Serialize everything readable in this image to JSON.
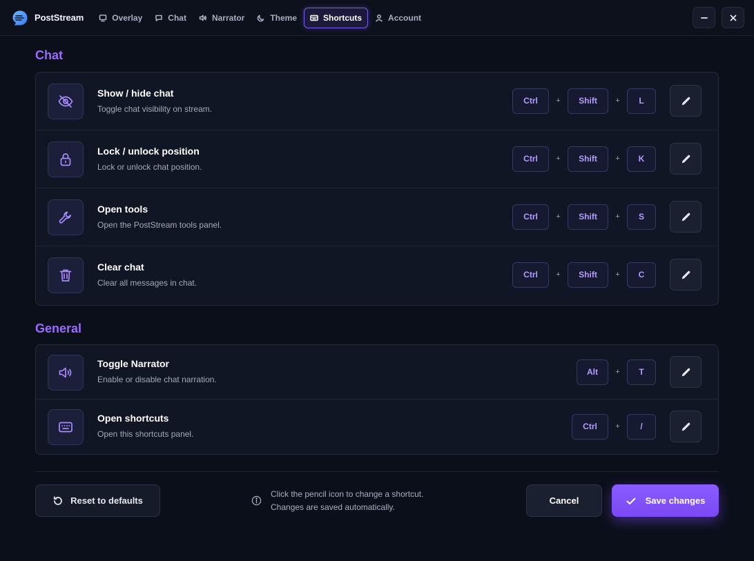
{
  "app": {
    "name": "PostStream",
    "logo_icon": "poststream-logo-icon"
  },
  "nav": {
    "items": [
      {
        "label": "Overlay",
        "icon": "monitor-icon",
        "active": false
      },
      {
        "label": "Chat",
        "icon": "chat-bubble-icon",
        "active": false
      },
      {
        "label": "Narrator",
        "icon": "speaker-icon",
        "active": false
      },
      {
        "label": "Theme",
        "icon": "moon-icon",
        "active": false
      },
      {
        "label": "Shortcuts",
        "icon": "keyboard-icon",
        "active": true
      },
      {
        "label": "Account",
        "icon": "user-icon",
        "active": false
      }
    ]
  },
  "window": {
    "minimize_icon": "minimize-icon",
    "close_icon": "close-icon"
  },
  "sections": [
    {
      "title": "Chat",
      "rows": [
        {
          "title": "Show / hide chat",
          "desc": "Toggle chat visibility on stream.",
          "icon": "eye-off-icon",
          "keys": [
            "Ctrl",
            "Shift",
            "L"
          ]
        },
        {
          "title": "Lock / unlock position",
          "desc": "Lock or unlock chat position.",
          "icon": "lock-icon",
          "keys": [
            "Ctrl",
            "Shift",
            "K"
          ]
        },
        {
          "title": "Open tools",
          "desc": "Open the PostStream tools panel.",
          "icon": "wrench-icon",
          "keys": [
            "Ctrl",
            "Shift",
            "S"
          ]
        },
        {
          "title": "Clear chat",
          "desc": "Clear all messages in chat.",
          "icon": "trash-icon",
          "keys": [
            "Ctrl",
            "Shift",
            "C"
          ]
        }
      ]
    },
    {
      "title": "General",
      "rows": [
        {
          "title": "Toggle Narrator",
          "desc": "Enable or disable chat narration.",
          "icon": "speaker-icon",
          "keys": [
            "Alt",
            "T"
          ]
        },
        {
          "title": "Open shortcuts",
          "desc": "Open this shortcuts panel.",
          "icon": "keyboard-icon",
          "keys": [
            "Ctrl",
            "/"
          ]
        }
      ]
    }
  ],
  "key_separator": "+",
  "footer": {
    "reset_label": "Reset to defaults",
    "hint_line1": "Click the pencil icon to change a shortcut.",
    "hint_line2": "Changes are saved automatically.",
    "cancel_label": "Cancel",
    "save_label": "Save changes"
  },
  "colors": {
    "accent": "#8a5cff",
    "background": "#0b0f1a",
    "panel": "#111624",
    "key_text": "#b69cff"
  }
}
